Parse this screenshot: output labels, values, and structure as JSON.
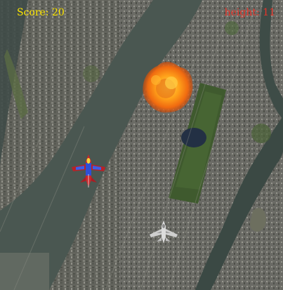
{
  "hud": {
    "score_text": "Score: 20",
    "height_text": "height: 11",
    "score_color": "#ffe800",
    "height_color": "#e8342a"
  },
  "sprites": {
    "player_jet": "red-blue-fighter-jet",
    "enemy_jet": "white-fighter-jet",
    "explosion": "fireball-explosion"
  },
  "background": "satellite-city-map"
}
